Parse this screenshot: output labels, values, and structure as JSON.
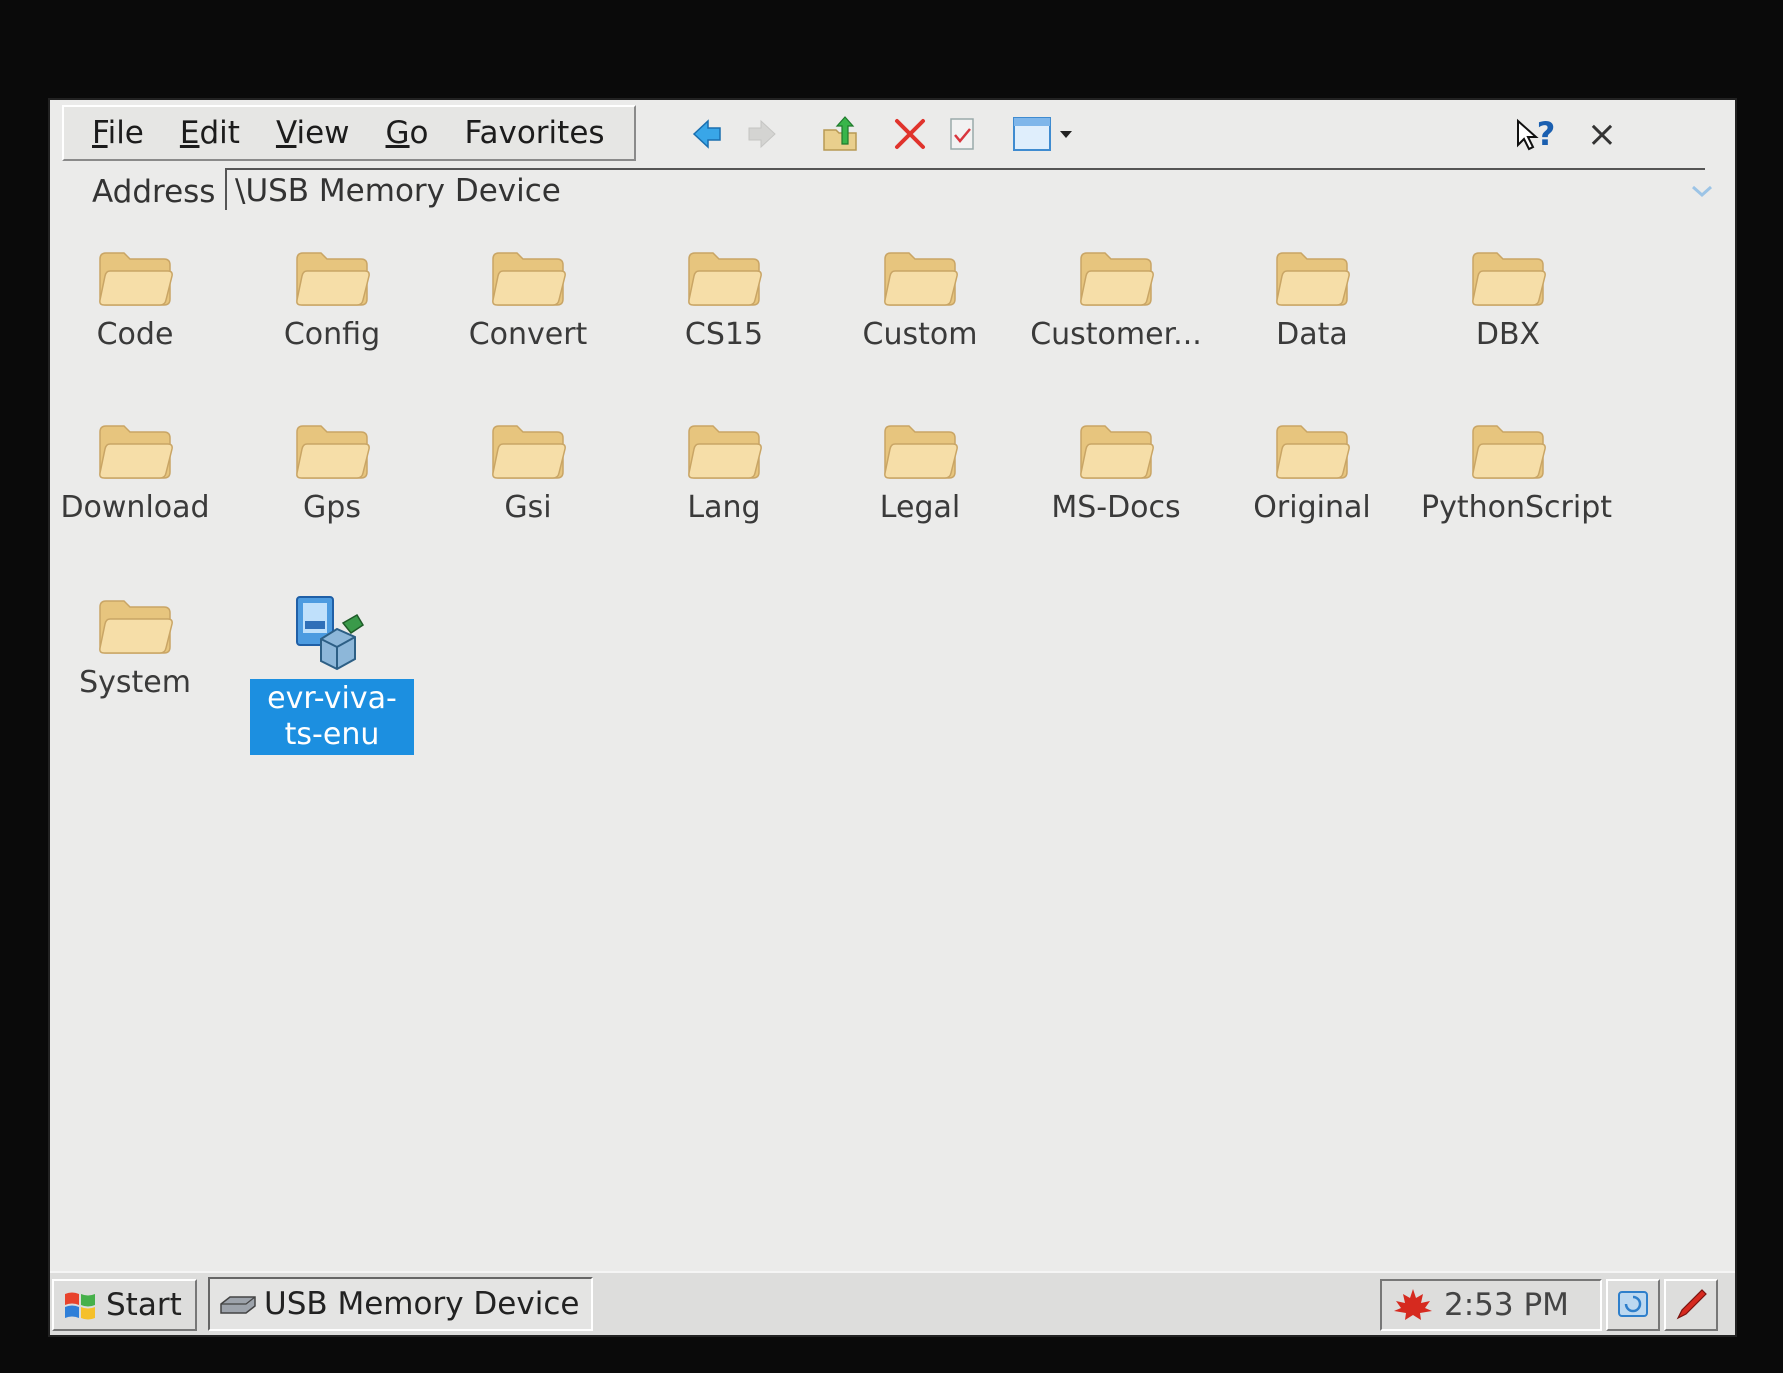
{
  "menu": {
    "file": {
      "u": "F",
      "rest": "ile"
    },
    "edit": {
      "u": "E",
      "rest": "dit"
    },
    "view": {
      "u": "V",
      "rest": "iew"
    },
    "go": {
      "u": "G",
      "rest": "o"
    },
    "favorites": {
      "u": "",
      "rest": "Favorites"
    }
  },
  "toolbar": {
    "icons": [
      "back-icon",
      "forward-icon",
      "up-folder-icon",
      "delete-icon",
      "properties-icon",
      "views-icon",
      "help-icon",
      "close-icon"
    ],
    "help_label": "?",
    "close_label": "×"
  },
  "address": {
    "label": "Address",
    "value": "\\USB Memory Device"
  },
  "items": [
    {
      "label": "Code",
      "type": "folder"
    },
    {
      "label": "Config",
      "type": "folder"
    },
    {
      "label": "Convert",
      "type": "folder"
    },
    {
      "label": "CS15",
      "type": "folder"
    },
    {
      "label": "Custom",
      "type": "folder"
    },
    {
      "label": "Customer...",
      "type": "folder"
    },
    {
      "label": "Data",
      "type": "folder"
    },
    {
      "label": "DBX",
      "type": "folder"
    },
    {
      "label": "Download",
      "type": "folder"
    },
    {
      "label": "Gps",
      "type": "folder"
    },
    {
      "label": "Gsi",
      "type": "folder"
    },
    {
      "label": "Lang",
      "type": "folder"
    },
    {
      "label": "Legal",
      "type": "folder"
    },
    {
      "label": "MS-Docs",
      "type": "folder"
    },
    {
      "label": "Original",
      "type": "folder"
    },
    {
      "label": "PythonScript",
      "type": "folder"
    },
    {
      "label": "System",
      "type": "folder"
    },
    {
      "label": "evr-viva-ts-enu",
      "type": "installer",
      "selected": true
    }
  ],
  "taskbar": {
    "start_label": "Start",
    "task_label": "USB Memory Device",
    "clock": "2:53 PM"
  },
  "colors": {
    "selection": "#1c8fe0",
    "folder": "#f0d69a",
    "background": "#ebebea"
  }
}
